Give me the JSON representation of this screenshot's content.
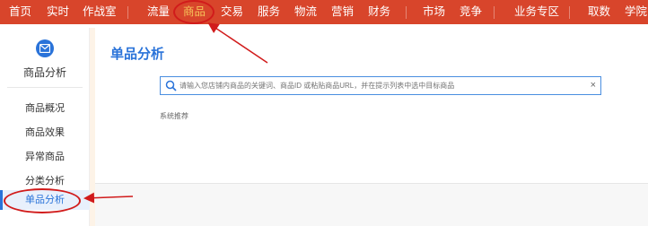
{
  "topnav": {
    "items": [
      "首页",
      "实时",
      "作战室",
      "流量",
      "商品",
      "交易",
      "服务",
      "物流",
      "营销",
      "财务",
      "市场",
      "竞争",
      "业务专区",
      "取数",
      "学院"
    ],
    "active": "商品"
  },
  "sidebar": {
    "header_title": "商品分析",
    "items": [
      "商品概况",
      "商品效果",
      "异常商品",
      "分类分析",
      "单品分析"
    ],
    "active": "单品分析"
  },
  "main": {
    "page_title": "单品分析",
    "search": {
      "placeholder": "请输入您店铺内商品的关键词、商品ID 或粘贴商品URL，并在提示列表中选中目标商品",
      "clear_label": "×"
    },
    "hint_label": "系统推荐"
  },
  "colors": {
    "nav_bg": "#d8452b",
    "accent_blue": "#2a73d9",
    "annotation_red": "#d11b1b"
  }
}
